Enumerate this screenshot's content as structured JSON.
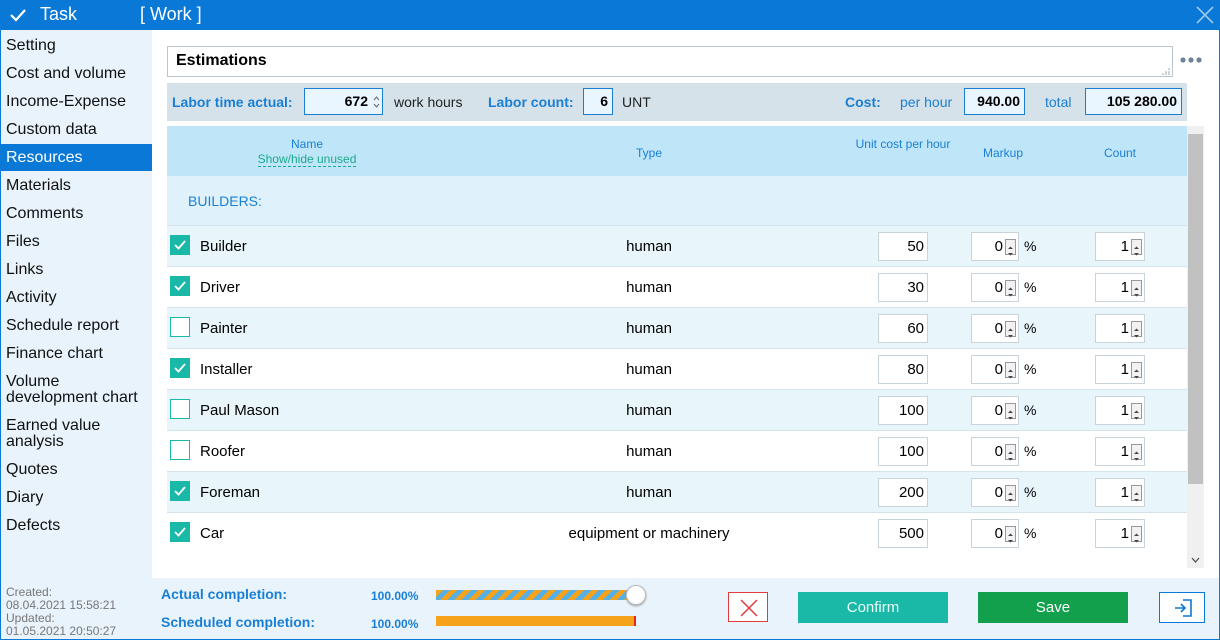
{
  "window": {
    "title": "Task",
    "subtitle": "[ Work ]"
  },
  "sidebar": {
    "items": [
      {
        "label": "Setting"
      },
      {
        "label": "Cost and volume"
      },
      {
        "label": "Income-Expense"
      },
      {
        "label": "Custom data"
      },
      {
        "label": "Resources",
        "active": true
      },
      {
        "label": "Materials"
      },
      {
        "label": "Comments"
      },
      {
        "label": "Files"
      },
      {
        "label": "Links"
      },
      {
        "label": "Activity"
      },
      {
        "label": "Schedule report"
      },
      {
        "label": "Finance chart"
      },
      {
        "label": "Volume development chart"
      },
      {
        "label": "Earned value analysis"
      },
      {
        "label": "Quotes"
      },
      {
        "label": "Diary"
      },
      {
        "label": "Defects"
      }
    ]
  },
  "main": {
    "section_title": "Estimations",
    "labor_time_label": "Labor time actual:",
    "labor_time_value": "672",
    "labor_time_unit": "work hours",
    "labor_count_label": "Labor count:",
    "labor_count_value": "6",
    "labor_count_unit": "UNT",
    "cost_label": "Cost:",
    "per_hour_label": "per hour",
    "per_hour_value": "940.00",
    "total_label": "total",
    "total_value": "105 280.00"
  },
  "table": {
    "headers": {
      "name": "Name",
      "show_hide": "Show/hide unused",
      "type": "Type",
      "unit_cost": "Unit cost per hour",
      "markup": "Markup",
      "count": "Count"
    },
    "group_label": "BUILDERS:",
    "rows": [
      {
        "name": "Builder",
        "type": "human",
        "unit_cost": "50",
        "markup": "0",
        "count": "1",
        "checked": true
      },
      {
        "name": "Driver",
        "type": "human",
        "unit_cost": "30",
        "markup": "0",
        "count": "1",
        "checked": true
      },
      {
        "name": "Painter",
        "type": "human",
        "unit_cost": "60",
        "markup": "0",
        "count": "1",
        "checked": false
      },
      {
        "name": "Installer",
        "type": "human",
        "unit_cost": "80",
        "markup": "0",
        "count": "1",
        "checked": true
      },
      {
        "name": "Paul Mason",
        "type": "human",
        "unit_cost": "100",
        "markup": "0",
        "count": "1",
        "checked": false
      },
      {
        "name": "Roofer",
        "type": "human",
        "unit_cost": "100",
        "markup": "0",
        "count": "1",
        "checked": false
      },
      {
        "name": "Foreman",
        "type": "human",
        "unit_cost": "200",
        "markup": "0",
        "count": "1",
        "checked": true
      },
      {
        "name": "Car",
        "type": "equipment or machinery",
        "unit_cost": "500",
        "markup": "0",
        "count": "1",
        "checked": true
      }
    ],
    "percent_sign": "%"
  },
  "footer": {
    "created_label": "Created:",
    "created_value": "08.04.2021 15:58:21",
    "updated_label": "Updated:",
    "updated_value": "01.05.2021 20:50:27",
    "actual_label": "Actual completion:",
    "actual_value": "100.00%",
    "actual_fraction": 1.0,
    "scheduled_label": "Scheduled completion:",
    "scheduled_value": "100.00%",
    "scheduled_fraction": 1.0,
    "confirm_label": "Confirm",
    "save_label": "Save"
  },
  "icons": {
    "title_check": "check-icon",
    "close": "close-icon",
    "more": "more-dots-icon",
    "cancel": "cancel-x-icon",
    "exit": "exit-icon"
  },
  "colors": {
    "accent": "#0a78d7",
    "teal": "#1ab8a6",
    "save_green": "#12a04d",
    "progress_orange": "#f7a21b"
  }
}
